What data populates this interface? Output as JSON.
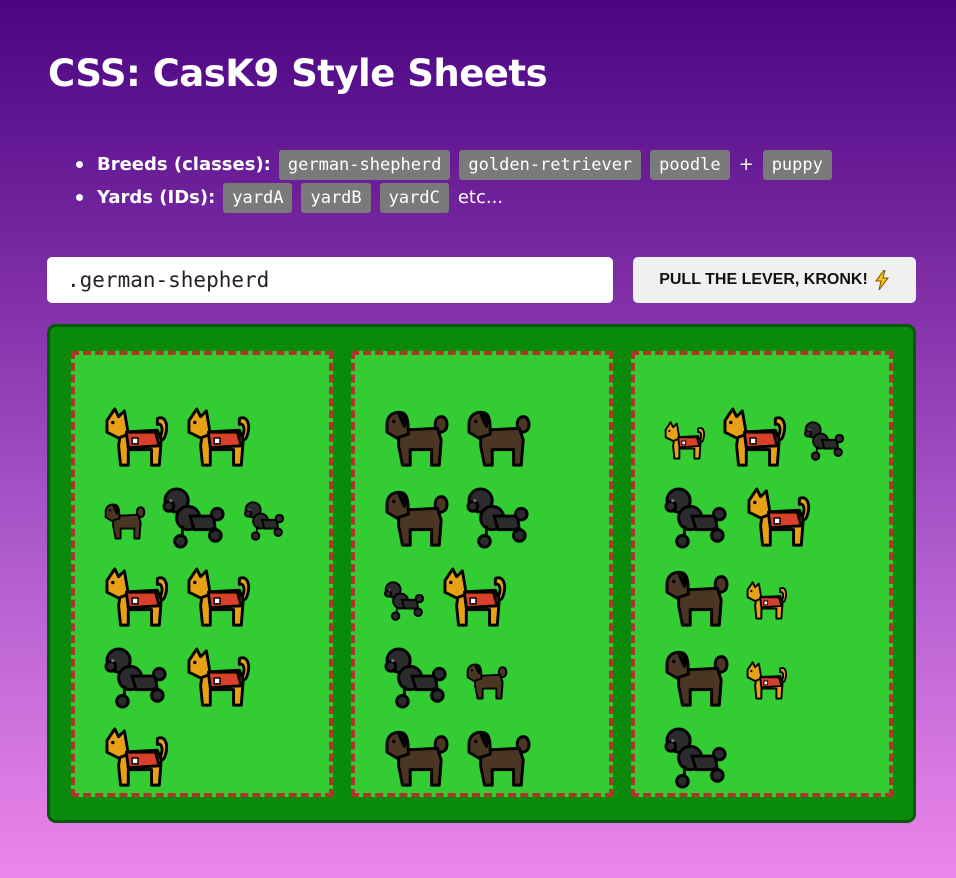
{
  "title": "CSS: CasK9 Style Sheets",
  "legend": {
    "breeds_label": "Breeds (classes):",
    "breeds": [
      "german-shepherd",
      "golden-retriever",
      "poodle"
    ],
    "plus": "+",
    "modifier": "puppy",
    "yards_label": "Yards (IDs):",
    "yards": [
      "yardA",
      "yardB",
      "yardC"
    ],
    "etc": "etc..."
  },
  "selector_input": {
    "value": ".german-shepherd"
  },
  "lever_button": {
    "label": "PULL THE LEVER, KRONK!",
    "icon": "lightning-icon"
  },
  "colors": {
    "german_shepherd": "#e8a116",
    "german_shepherd_vest": "#d8402a",
    "golden_retriever": "#4a3622",
    "poodle": "#2b2b2b",
    "yard_grass": "#33cc33",
    "yard_border": "#b0342c",
    "playground": "#0a8a0a"
  },
  "yards": [
    {
      "id": "yardA",
      "rows": [
        [
          {
            "breed": "german-shepherd"
          },
          {
            "breed": "german-shepherd"
          }
        ],
        [
          {
            "breed": "golden-retriever",
            "puppy": true
          },
          {
            "breed": "poodle"
          },
          {
            "breed": "poodle",
            "puppy": true
          }
        ],
        [
          {
            "breed": "german-shepherd"
          },
          {
            "breed": "german-shepherd"
          }
        ],
        [
          {
            "breed": "poodle"
          },
          {
            "breed": "german-shepherd"
          }
        ],
        [
          {
            "breed": "german-shepherd"
          }
        ]
      ]
    },
    {
      "id": "yardB",
      "rows": [
        [
          {
            "breed": "golden-retriever"
          },
          {
            "breed": "golden-retriever"
          }
        ],
        [
          {
            "breed": "golden-retriever"
          },
          {
            "breed": "poodle"
          }
        ],
        [
          {
            "breed": "poodle",
            "puppy": true
          },
          {
            "breed": "german-shepherd"
          }
        ],
        [
          {
            "breed": "poodle"
          },
          {
            "breed": "golden-retriever",
            "puppy": true
          }
        ],
        [
          {
            "breed": "golden-retriever"
          },
          {
            "breed": "golden-retriever"
          }
        ]
      ]
    },
    {
      "id": "yardC",
      "rows": [
        [
          {
            "breed": "german-shepherd",
            "puppy": true
          },
          {
            "breed": "german-shepherd"
          },
          {
            "breed": "poodle",
            "puppy": true
          }
        ],
        [
          {
            "breed": "poodle"
          },
          {
            "breed": "german-shepherd"
          }
        ],
        [
          {
            "breed": "golden-retriever"
          },
          {
            "breed": "german-shepherd",
            "puppy": true
          }
        ],
        [
          {
            "breed": "golden-retriever"
          },
          {
            "breed": "german-shepherd",
            "puppy": true
          }
        ],
        [
          {
            "breed": "poodle"
          }
        ]
      ]
    }
  ]
}
